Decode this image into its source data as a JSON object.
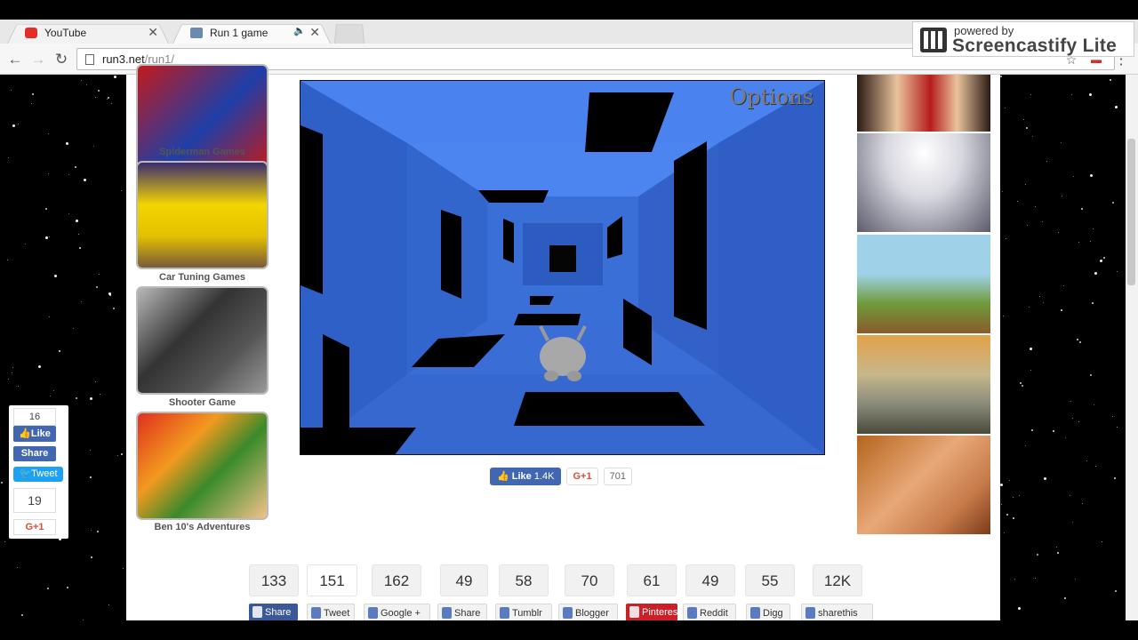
{
  "browser": {
    "tabs": [
      {
        "title": "YouTube",
        "active": false
      },
      {
        "title": "Run 1 game",
        "active": true
      }
    ],
    "url_host": "run3.net",
    "url_path": "/run1/"
  },
  "watermark": {
    "line1": "powered by",
    "line2": "Screencastify Lite"
  },
  "left_thumbs": [
    {
      "caption": "Spiderman Games"
    },
    {
      "caption": "Car Tuning Games"
    },
    {
      "caption": "Shooter Game"
    },
    {
      "caption": "Ben 10's Adventures"
    }
  ],
  "game": {
    "options_label": "Options"
  },
  "under_game": {
    "like_label": "Like",
    "like_count": "1.4K",
    "gplus_label": "G+1",
    "gplus_count": "701"
  },
  "share_sidebar": {
    "count_top": "16",
    "like": "Like",
    "share": "Share",
    "tweet": "Tweet",
    "count_bottom": "19",
    "gplus": "G+1"
  },
  "share_bar": {
    "items": [
      {
        "count": "133",
        "label": "Share",
        "color": "#3b5998"
      },
      {
        "count": "151",
        "label": "Tweet",
        "color": "#ffffff"
      },
      {
        "count": "162",
        "label": "Google +",
        "color": "#ffffff"
      },
      {
        "count": "49",
        "label": "Share",
        "color": "#ffffff"
      },
      {
        "count": "58",
        "label": "Tumblr",
        "color": "#ffffff"
      },
      {
        "count": "70",
        "label": "Blogger",
        "color": "#ffffff"
      },
      {
        "count": "61",
        "label": "Pinterest",
        "color": "#cb2027"
      },
      {
        "count": "49",
        "label": "Reddit",
        "color": "#ffffff"
      },
      {
        "count": "55",
        "label": "Digg",
        "color": "#ffffff"
      },
      {
        "count": "12K",
        "label": "sharethis",
        "color": "#ffffff"
      }
    ]
  },
  "colors": {
    "game_bg": "#3a6fd8",
    "facebook": "#4267b2",
    "twitter": "#1da1f2"
  }
}
